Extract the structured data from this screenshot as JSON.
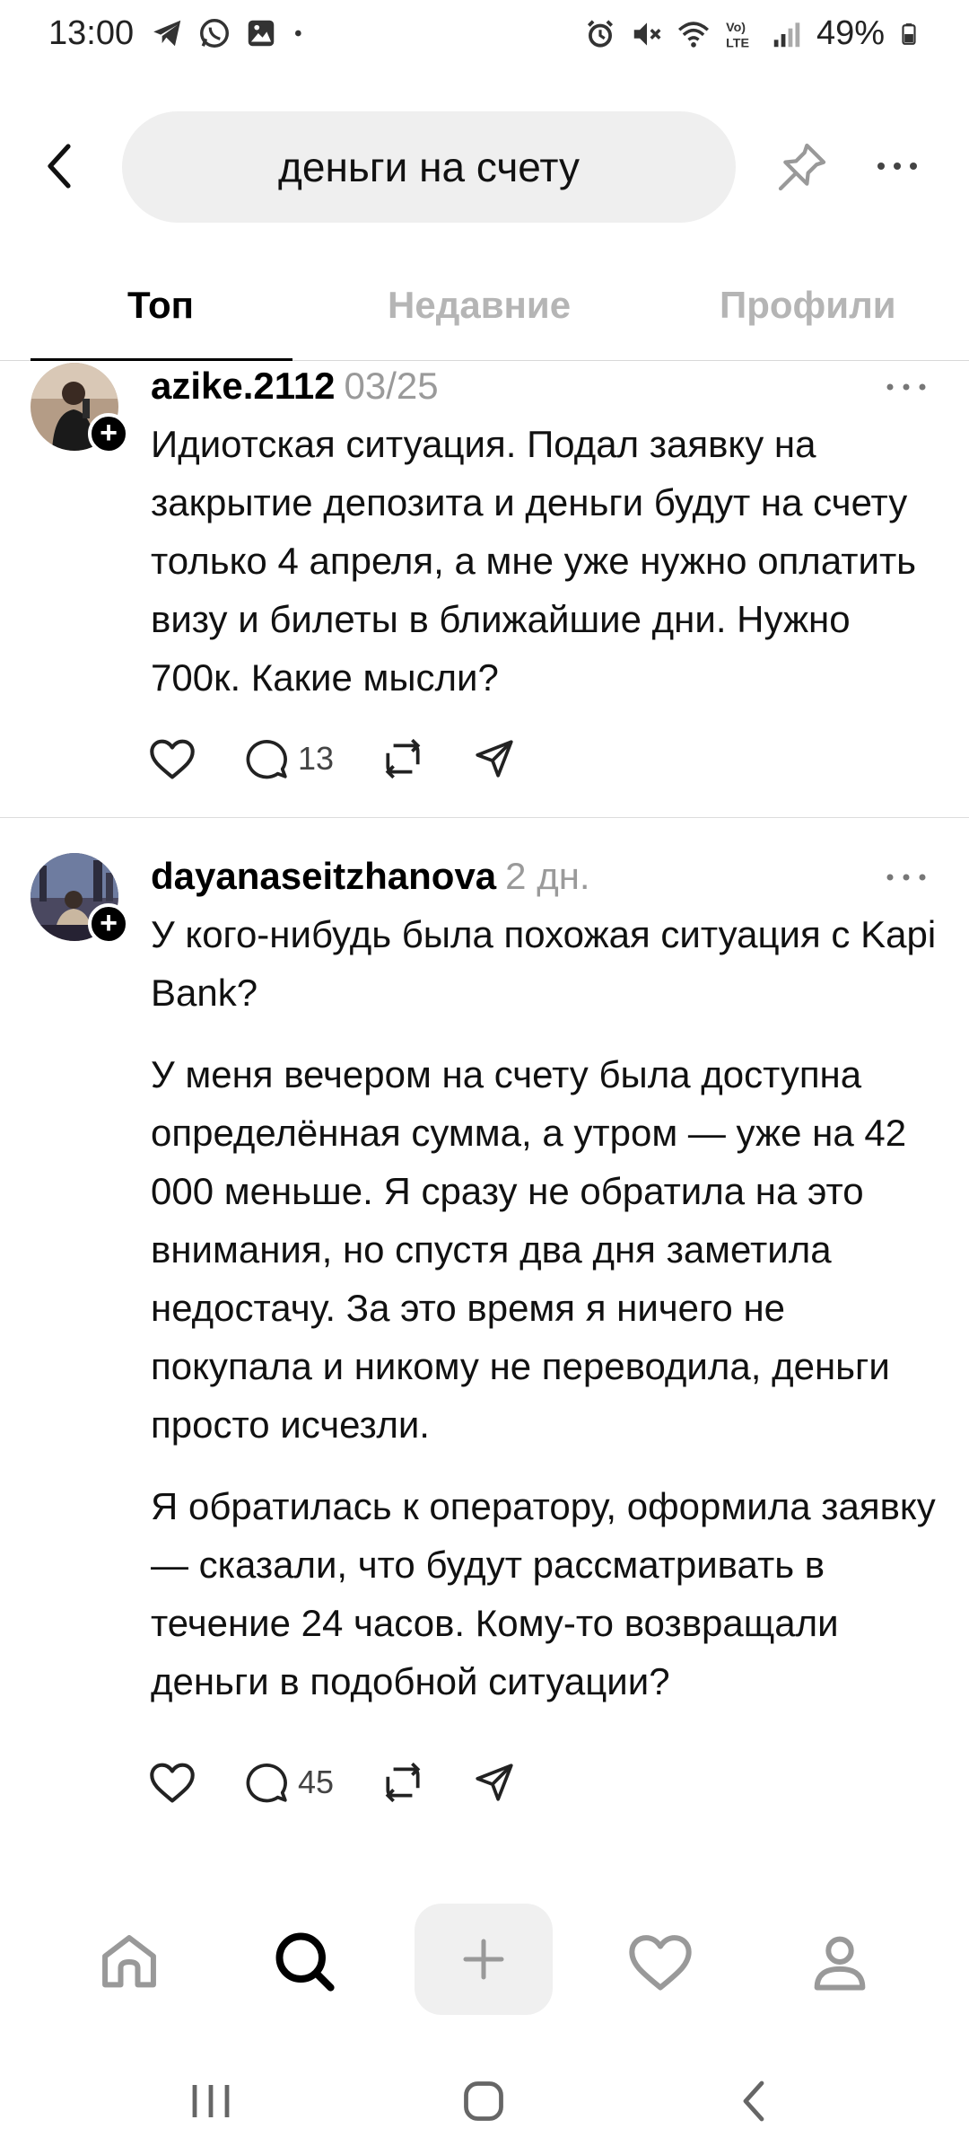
{
  "status_bar": {
    "time": "13:00",
    "battery": "49%",
    "icons_left": [
      "telegram-icon",
      "whatsapp-icon",
      "gallery-icon",
      "dot-icon"
    ],
    "icons_right": [
      "alarm-icon",
      "mute-icon",
      "wifi-icon",
      "volte-icon",
      "signal-icon",
      "battery-icon"
    ]
  },
  "header": {
    "search_query": "деньги на счету"
  },
  "tabs": [
    {
      "label": "Топ",
      "active": true
    },
    {
      "label": "Недавние",
      "active": false
    },
    {
      "label": "Профили",
      "active": false
    }
  ],
  "posts": [
    {
      "username": "azike.2112",
      "time": "03/25",
      "paragraphs": [
        "Идиотская ситуация. Подал заявку на закрытие депозита и деньги будут на счету только 4 апреля, а мне уже нужно оплатить визу и билеты в ближайшие дни. Нужно 700к. Какие мысли?"
      ],
      "replies": "13"
    },
    {
      "username": "dayanaseitzhanova",
      "time": "2 дн.",
      "paragraphs": [
        "У кого-нибудь была похожая ситуация с Kapi Bank?",
        "У меня вечером на счету была доступна определённая сумма, а утром — уже на 42 000 меньше. Я сразу не обратила на это внимания, но спустя два дня заметила недостачу. За это время я ничего не покупала и никому не переводила, деньги просто исчезли.",
        "Я обратилась к оператору, оформила заявку — сказали, что будут рассматривать в течение 24 часов. Кому-то возвращали деньги в подобной ситуации?"
      ],
      "replies": "45"
    }
  ],
  "bottom_nav": [
    "home-icon",
    "search-icon",
    "plus-icon",
    "heart-icon",
    "profile-icon"
  ],
  "system_nav": [
    "recents-icon",
    "home-circle-icon",
    "back-icon"
  ]
}
